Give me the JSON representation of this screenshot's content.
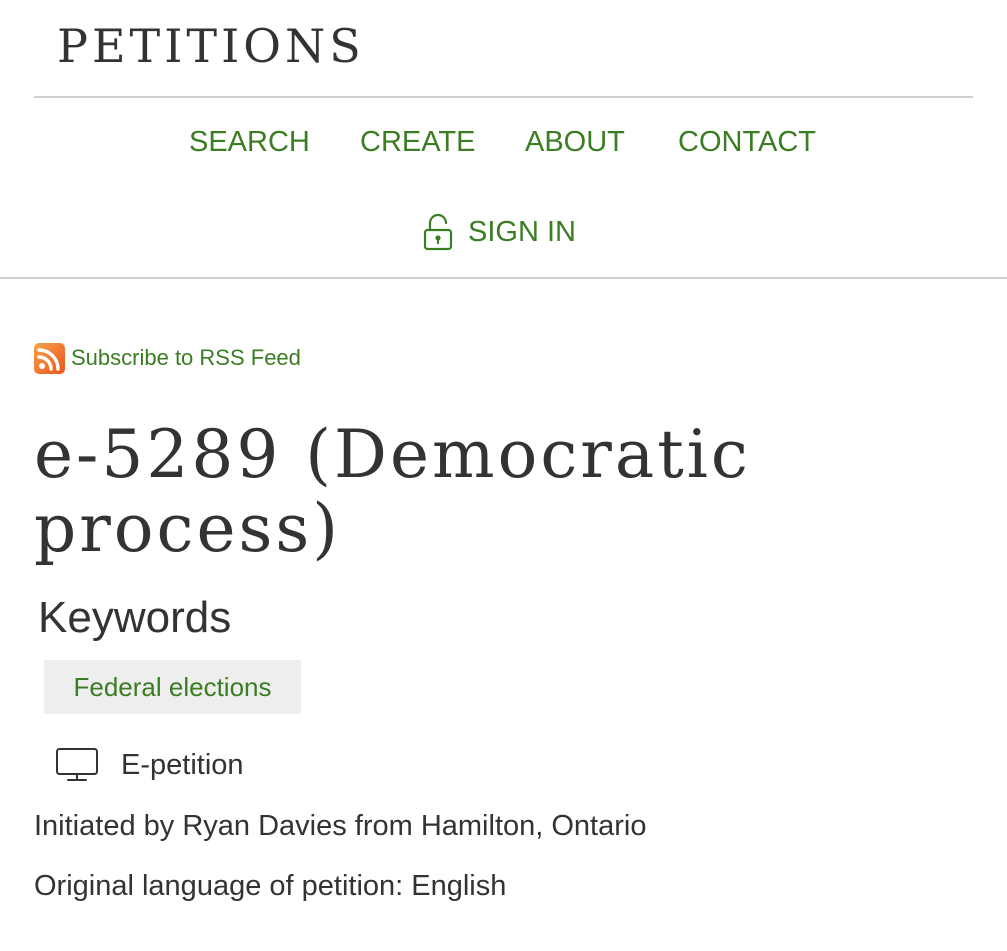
{
  "header": {
    "site_title": "PETITIONS",
    "nav": {
      "search": "SEARCH",
      "create": "CREATE",
      "about": "ABOUT",
      "contact": "CONTACT"
    },
    "sign_in": {
      "label": "SIGN IN",
      "icon": "unlock-icon"
    }
  },
  "rss": {
    "label": "Subscribe to RSS Feed",
    "icon": "rss-icon"
  },
  "petition": {
    "title": "e-5289 (Democratic process)",
    "keywords_heading": "Keywords",
    "keywords": [
      "Federal elections"
    ],
    "type": {
      "label": "E-petition",
      "icon": "monitor-icon"
    },
    "initiated_by": "Initiated by Ryan Davies from Hamilton, Ontario",
    "original_language": "Original language of petition: English"
  },
  "colors": {
    "link_green": "#3b7d23",
    "text_dark": "#333333",
    "chip_bg": "#eeeeee",
    "rss_orange": "#f26522",
    "divider": "#d0d0d0"
  }
}
